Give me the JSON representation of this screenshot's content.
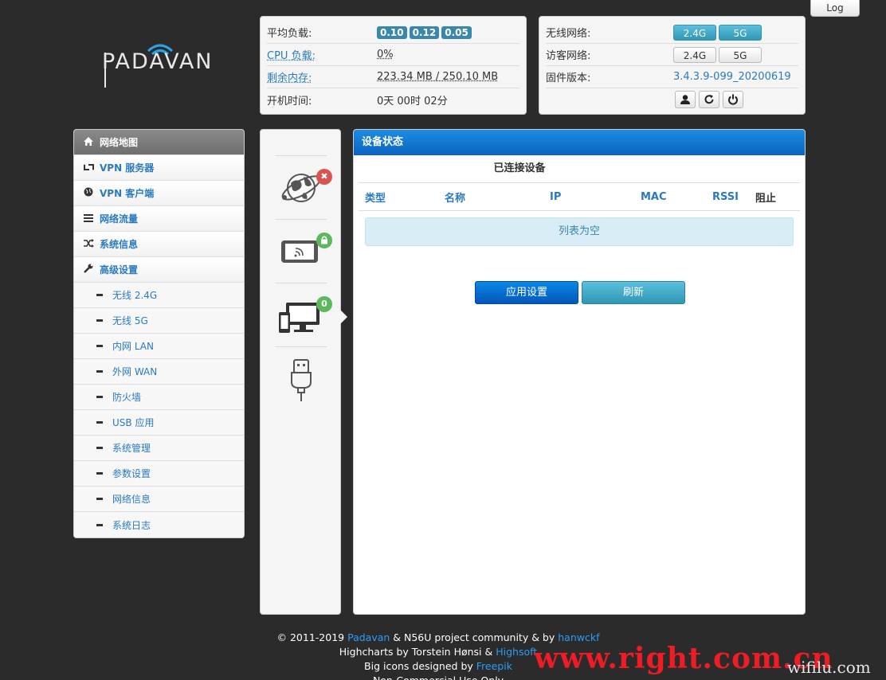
{
  "header": {
    "log_button": "Log",
    "logo_text": "PADAVAN"
  },
  "status": {
    "load_label": "平均负载:",
    "load_values": [
      "0.10",
      "0.12",
      "0.05"
    ],
    "cpu_label": "CPU 负载:",
    "cpu_value": "0%",
    "mem_label": "剩余内存:",
    "mem_value": "223.34 MB / 250.10 MB",
    "uptime_label": "开机时间:",
    "uptime_value": "0天 00时 02分"
  },
  "wireless": {
    "wifi_label": "无线网络:",
    "wifi_24": "2.4G",
    "wifi_5": "5G",
    "guest_label": "访客网络:",
    "guest_24": "2.4G",
    "guest_5": "5G",
    "fw_label": "固件版本:",
    "fw_value": "3.4.3.9-099_20200619"
  },
  "sidebar": {
    "items": [
      {
        "label": "网络地图",
        "icon": "home-icon"
      },
      {
        "label": "VPN 服务器",
        "icon": "retweet-icon"
      },
      {
        "label": "VPN 客户端",
        "icon": "globe-icon"
      },
      {
        "label": "网络流量",
        "icon": "list-icon"
      },
      {
        "label": "系统信息",
        "icon": "shuffle-icon"
      },
      {
        "label": "高级设置",
        "icon": "wrench-icon"
      }
    ],
    "subitems": [
      "无线 2.4G",
      "无线 5G",
      "内网 LAN",
      "外网 WAN",
      "防火墙",
      "USB 应用",
      "系统管理",
      "参数设置",
      "网络信息",
      "系统日志"
    ]
  },
  "icons": {
    "internet_badge": "✖",
    "client_badge": "0"
  },
  "main": {
    "title": "设备状态",
    "section_title": "已连接设备",
    "columns": [
      "类型",
      "名称",
      "IP",
      "MAC",
      "RSSI",
      "阻止"
    ],
    "empty_text": "列表为空",
    "apply_button": "应用设置",
    "refresh_button": "刷新"
  },
  "footer": {
    "line1_pre": "© 2011-2019 ",
    "line1_link1": "Padavan",
    "line1_mid": " & N56U project community & by ",
    "line1_link2": "hanwckf",
    "line2_pre": "Highcharts by Torstein Hønsi & ",
    "line2_link": "Highsoft",
    "line3_pre": "Big icons designed by ",
    "line3_link": "Freepik",
    "line4": "Non-Commercial Use Only"
  },
  "watermark": {
    "main": "www.right.com.cn",
    "secondary": "wifilu.com"
  },
  "colors": {
    "accent": "#0a64c0",
    "link": "#2a7ac0",
    "info": "#3a87ad",
    "danger": "#d9534f",
    "success": "#5cb85c"
  }
}
